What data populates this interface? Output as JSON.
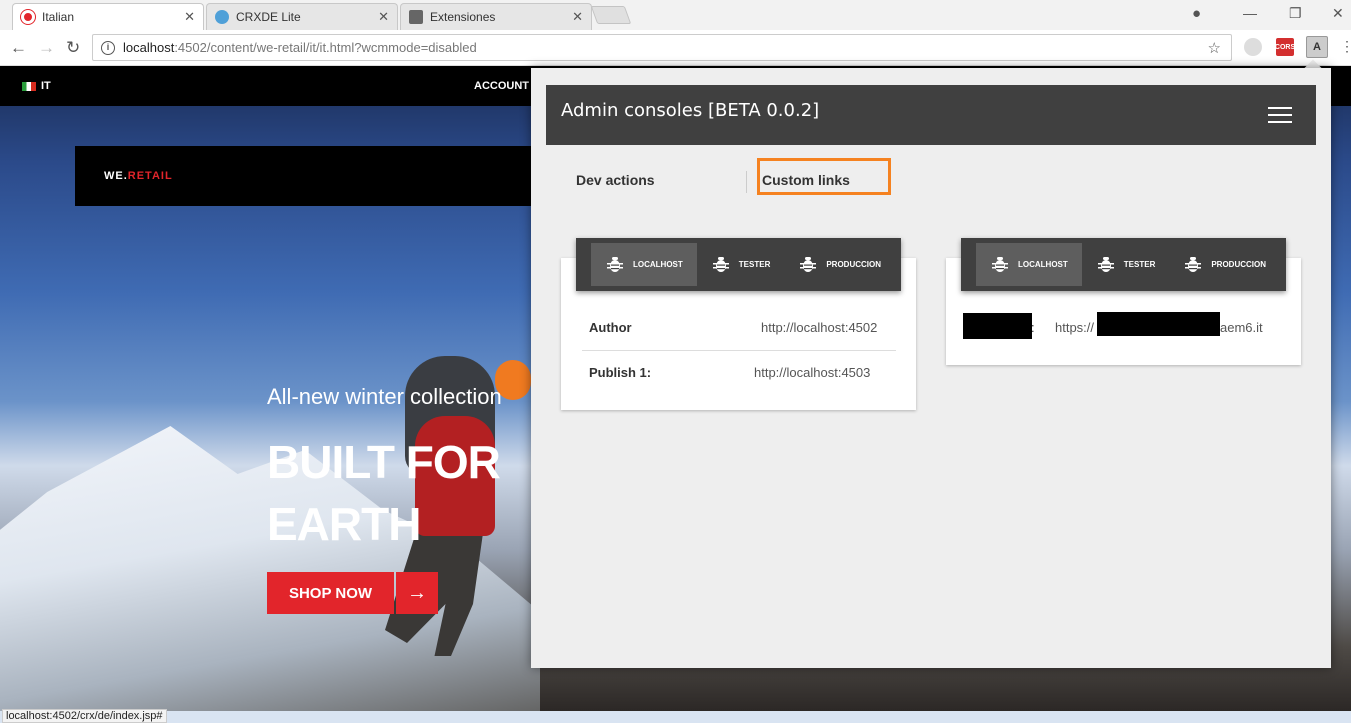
{
  "browser": {
    "tabs": [
      {
        "label": "Italian"
      },
      {
        "label": "CRXDE Lite"
      },
      {
        "label": "Extensiones"
      }
    ],
    "url_host": "localhost",
    "url_path": ":4502/content/we-retail/it/it.html?wcmmode=disabled",
    "extensions": [
      {
        "label": "CORS",
        "color": "#d32f2f"
      },
      {
        "label": "A",
        "color": "#757575"
      }
    ],
    "status_url": "localhost:4502/crx/de/index.jsp#"
  },
  "site": {
    "lang": "IT",
    "account": "ACCOUNT",
    "brand_prefix": "WE.",
    "brand_suffix": "RETAIL",
    "hero_subtitle": "All-new winter collection",
    "hero_title": "BUILT FOR EARTH",
    "shop_button": "SHOP NOW",
    "accent": "#e2252b"
  },
  "popup": {
    "title": "Admin consoles [BETA 0.0.2]",
    "tabs": [
      {
        "label": "Dev actions"
      },
      {
        "label": "Custom links"
      }
    ],
    "highlight_color": "#f58220",
    "left_panel": {
      "envs": [
        "LOCALHOST",
        "TESTER",
        "PRODUCCION"
      ],
      "selected_env": "LOCALHOST",
      "rows": [
        {
          "label": "Author",
          "value": "http://localhost:4502"
        },
        {
          "label": "Publish 1:",
          "value": "http://localhost:4503"
        }
      ]
    },
    "right_panel": {
      "envs": [
        "LOCALHOST",
        "TESTER",
        "PRODUCCION"
      ],
      "selected_env": "LOCALHOST",
      "row": {
        "separator": ":",
        "value_prefix": "https://",
        "value_suffix": "aem6.it"
      }
    }
  }
}
